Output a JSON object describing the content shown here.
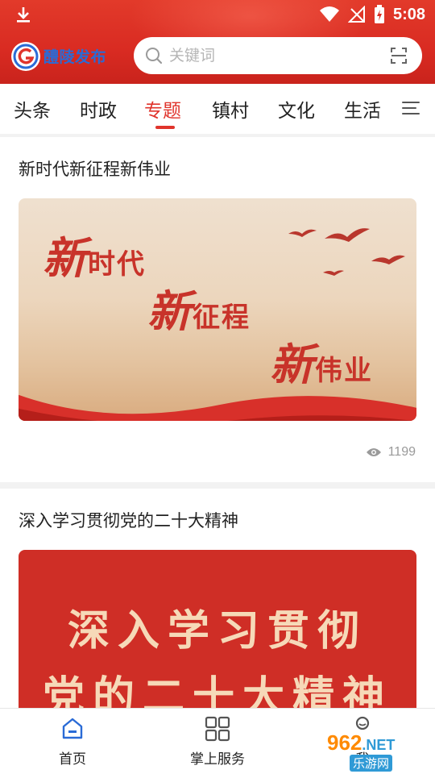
{
  "status_bar": {
    "time": "5:08"
  },
  "header": {
    "brand": "醴陵发布",
    "search_placeholder": "关键词"
  },
  "tabs": [
    {
      "label": "头条"
    },
    {
      "label": "时政"
    },
    {
      "label": "专题",
      "active": true
    },
    {
      "label": "镇村"
    },
    {
      "label": "文化"
    },
    {
      "label": "生活"
    }
  ],
  "articles": [
    {
      "title": "新时代新征程新伟业",
      "banner": {
        "line1_big": "新",
        "line1": "时代",
        "line2_big": "新",
        "line2": "征程",
        "line3_big": "新",
        "line3": "伟业"
      },
      "views": "1199"
    },
    {
      "title": "深入学习贯彻党的二十大精神",
      "banner": {
        "line1": "深入学习贯彻",
        "line2": "党的二十大精神"
      }
    }
  ],
  "bottom_nav": [
    {
      "label": "首页",
      "icon": "home-icon"
    },
    {
      "label": "掌上服务",
      "icon": "grid-icon"
    },
    {
      "label": "我",
      "icon": "user-icon"
    }
  ],
  "watermark": {
    "brand": "962",
    "suffix": ".NET",
    "sub": "乐游网"
  },
  "colors": {
    "primary": "#e0342c",
    "brand_blue": "#2a6bd6"
  }
}
